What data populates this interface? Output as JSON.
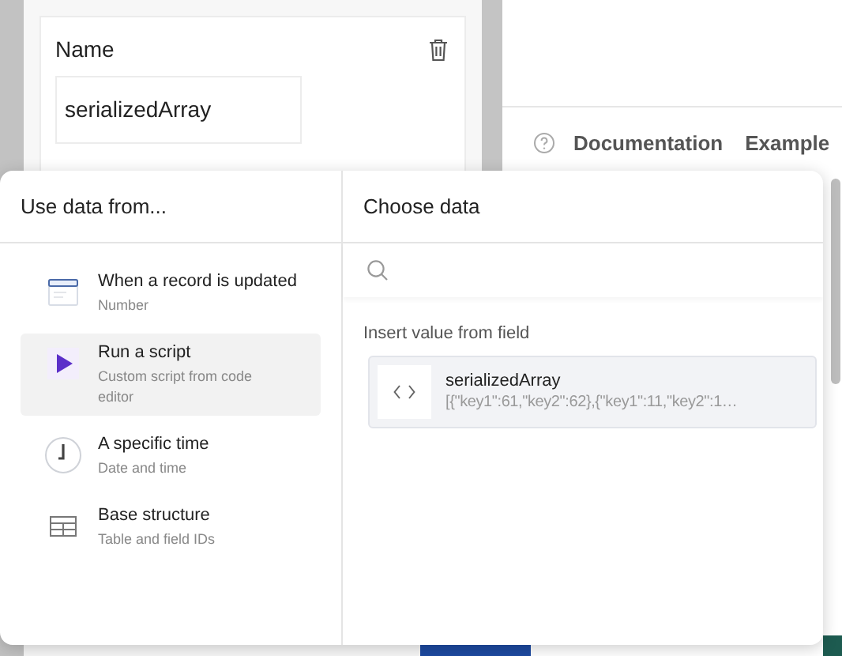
{
  "name_card": {
    "label": "Name",
    "value": "serializedArray"
  },
  "right_panel": {
    "tabs": [
      {
        "label": "Documentation"
      },
      {
        "label": "Example"
      }
    ]
  },
  "popup": {
    "sources_title": "Use data from...",
    "sources": [
      {
        "kind": "record",
        "title": "When a record is updated",
        "subtitle": "Number",
        "selected": false
      },
      {
        "kind": "script",
        "title": "Run a script",
        "subtitle": "Custom script from code editor",
        "selected": true
      },
      {
        "kind": "time",
        "title": "A specific time",
        "subtitle": "Date and time",
        "selected": false
      },
      {
        "kind": "structure",
        "title": "Base structure",
        "subtitle": "Table and field IDs",
        "selected": false
      }
    ],
    "data_title": "Choose data",
    "section_label": "Insert value from field",
    "fields": [
      {
        "name": "serializedArray",
        "value": "[{\"key1\":61,\"key2\":62},{\"key1\":11,\"key2\":1…"
      }
    ]
  }
}
